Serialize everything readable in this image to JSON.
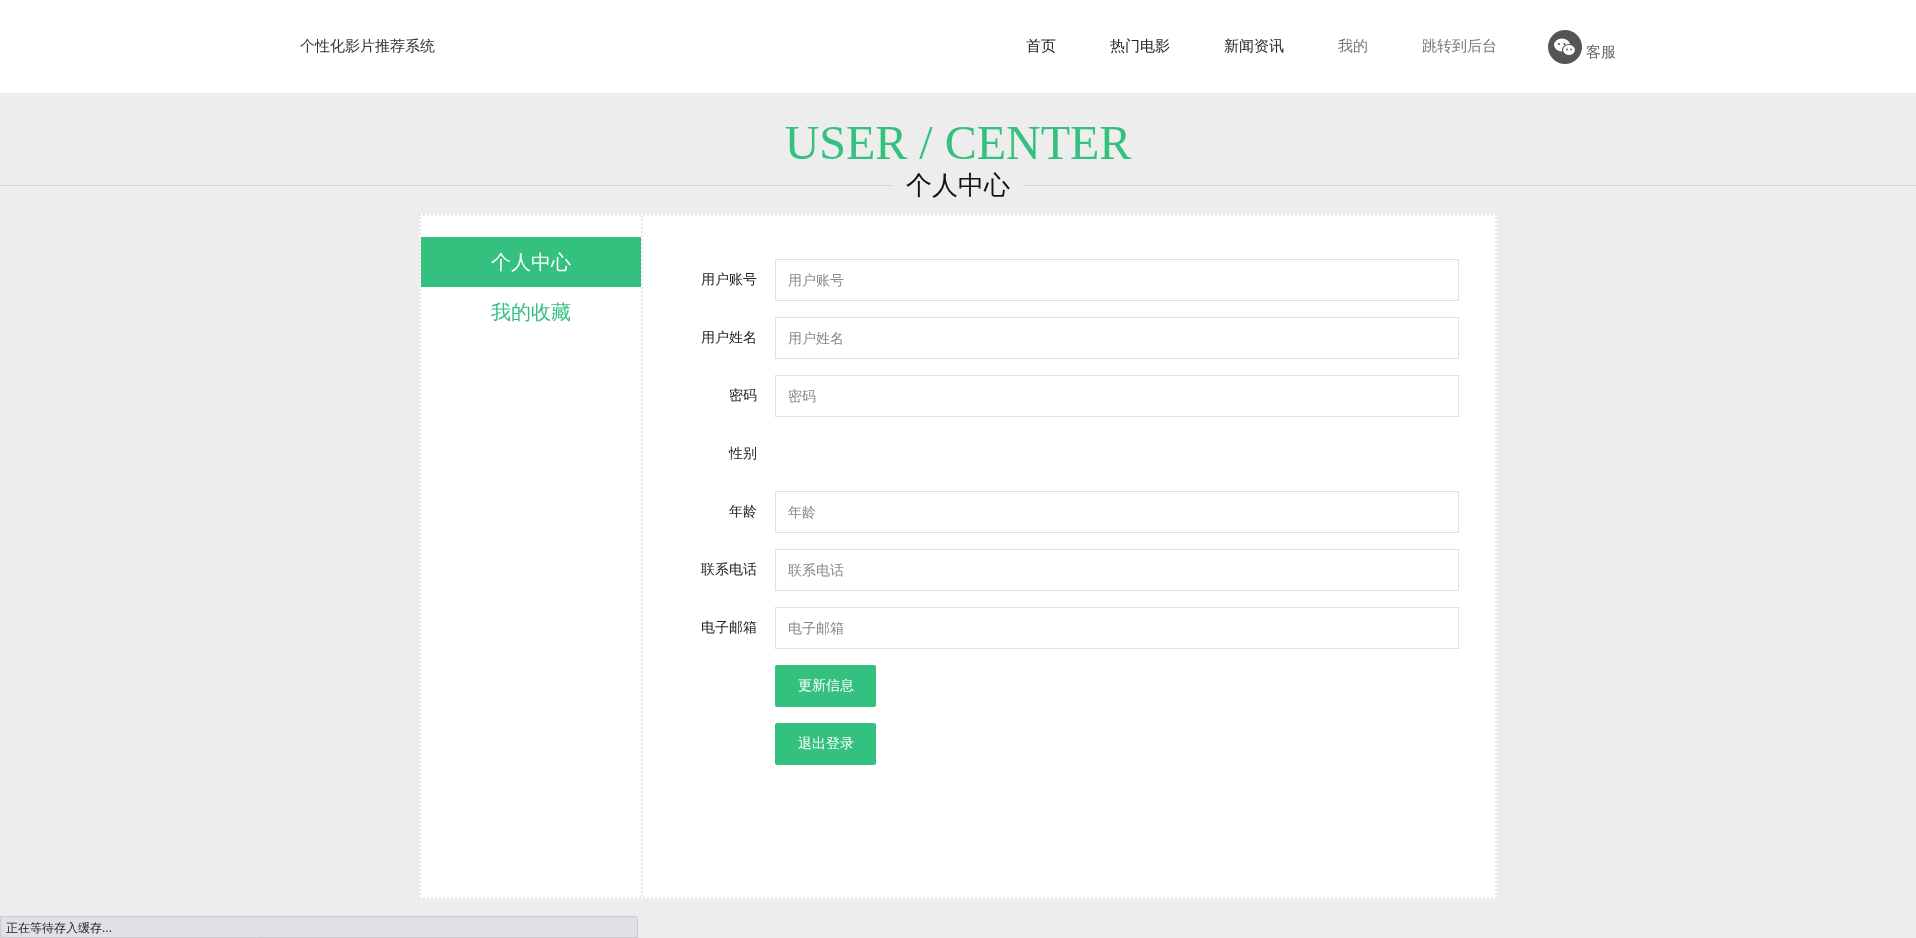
{
  "header": {
    "brand": "个性化影片推荐系统",
    "nav": [
      {
        "label": "首页",
        "dimmed": false
      },
      {
        "label": "热门电影",
        "dimmed": false
      },
      {
        "label": "新闻资讯",
        "dimmed": false
      },
      {
        "label": "我的",
        "dimmed": true
      },
      {
        "label": "跳转到后台",
        "dimmed": true
      }
    ],
    "service": "客服"
  },
  "banner": {
    "title": "USER / CENTER",
    "subtitle": "个人中心"
  },
  "sidebar": {
    "items": [
      {
        "label": "个人中心",
        "selected": true
      },
      {
        "label": "我的收藏",
        "selected": false
      }
    ]
  },
  "form": {
    "fields": [
      {
        "kind": "input",
        "label": "用户账号",
        "placeholder": "用户账号"
      },
      {
        "kind": "input",
        "label": "用户姓名",
        "placeholder": "用户姓名"
      },
      {
        "kind": "input",
        "label": "密码",
        "placeholder": "密码"
      },
      {
        "kind": "empty",
        "label": "性别"
      },
      {
        "kind": "input",
        "label": "年龄",
        "placeholder": "年龄"
      },
      {
        "kind": "input",
        "label": "联系电话",
        "placeholder": "联系电话"
      },
      {
        "kind": "input",
        "label": "电子邮箱",
        "placeholder": "电子邮箱"
      }
    ],
    "buttons": [
      "更新信息",
      "退出登录"
    ]
  },
  "status_bar": "正在等待存入缓存..."
}
